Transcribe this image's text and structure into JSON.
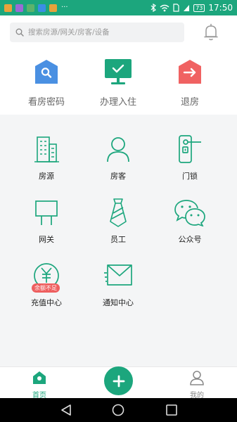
{
  "status_bar": {
    "time": "17:50",
    "battery": "73",
    "overflow": "···",
    "app_icon_colors": [
      "#e8a33c",
      "#9b6bd6",
      "#5db36b",
      "#3a8ee6",
      "#e6a23c"
    ]
  },
  "search": {
    "placeholder": "搜索房源/网关/房客/设备"
  },
  "quick_actions": [
    {
      "label": "看房密码",
      "icon": "house-search-icon",
      "color": "#4a90e2"
    },
    {
      "label": "办理入住",
      "icon": "monitor-check-icon",
      "color": "#1ca67d"
    },
    {
      "label": "退房",
      "icon": "house-exit-icon",
      "color": "#f06262"
    }
  ],
  "grid": [
    {
      "label": "房源",
      "icon": "building-icon"
    },
    {
      "label": "房客",
      "icon": "person-icon"
    },
    {
      "label": "门锁",
      "icon": "door-lock-icon"
    },
    {
      "label": "网关",
      "icon": "gateway-icon"
    },
    {
      "label": "员工",
      "icon": "staff-tie-icon"
    },
    {
      "label": "公众号",
      "icon": "wechat-icon"
    },
    {
      "label": "充值中心",
      "icon": "yen-coin-icon",
      "badge": "余额不足"
    },
    {
      "label": "通知中心",
      "icon": "envelope-icon"
    }
  ],
  "tabs": [
    {
      "label": "首页",
      "icon": "home-icon",
      "active": true
    },
    {
      "label": "我的",
      "icon": "user-icon",
      "active": false
    }
  ],
  "colors": {
    "accent": "#1ca67d",
    "badge": "#ee5f5f",
    "inactive": "#888888"
  }
}
